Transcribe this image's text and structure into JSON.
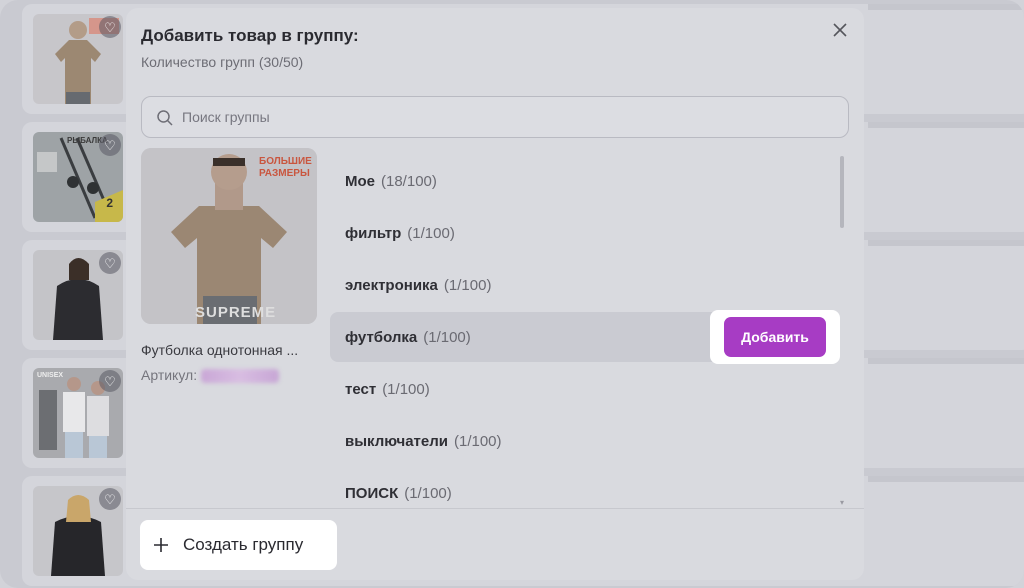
{
  "modal": {
    "title": "Добавить товар в группу:",
    "subtitle": "Количество групп (30/50)",
    "search_placeholder": "Поиск группы",
    "product": {
      "name": "Футболка однотонная ...",
      "article_label": "Артикул:",
      "image_text_line1": "БОЛЬШИЕ",
      "image_text_line2": "РАЗМЕРЫ",
      "image_brand": "SUPREME"
    },
    "groups": [
      {
        "name": "Мое",
        "count": "(18/100)"
      },
      {
        "name": "фильтр",
        "count": "(1/100)"
      },
      {
        "name": "электроника",
        "count": "(1/100)"
      },
      {
        "name": "футболка",
        "count": "(1/100)"
      },
      {
        "name": "тест",
        "count": "(1/100)"
      },
      {
        "name": "выключатели",
        "count": "(1/100)"
      },
      {
        "name": "ПОИСК",
        "count": "(1/100)"
      }
    ],
    "add_label": "Добавить",
    "create_label": "Создать группу"
  },
  "background": {
    "thumb2_label": "РЫБАЛКА",
    "thumb2_badge": "2",
    "thumb4_label": "UNISEX"
  },
  "colors": {
    "accent": "#a73cc4",
    "overlay": "#d9dadf"
  },
  "icons": [
    "heart-icon",
    "close-icon",
    "search-icon",
    "plus-icon"
  ]
}
